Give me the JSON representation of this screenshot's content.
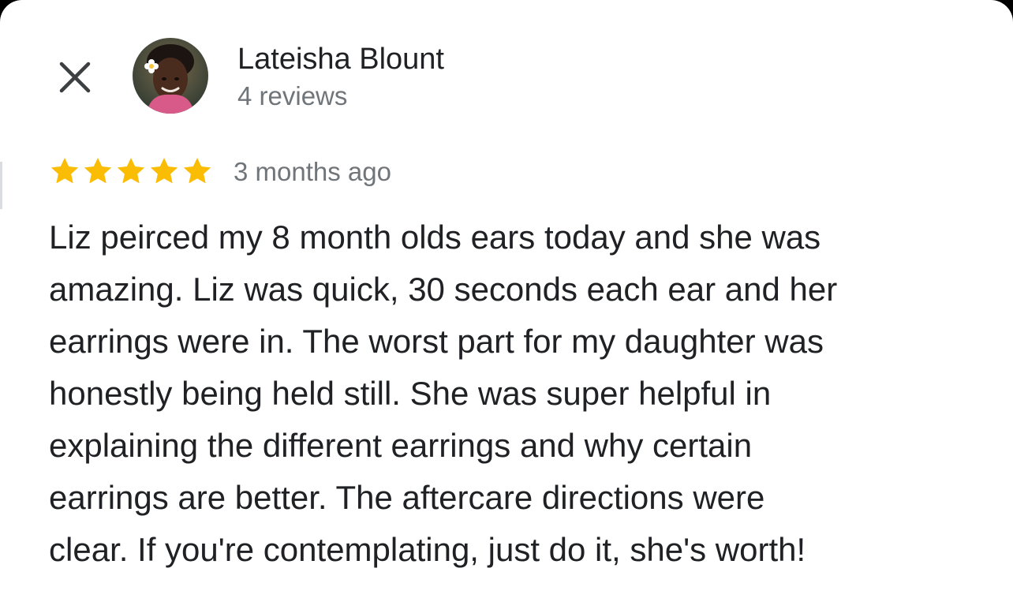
{
  "reviewer": {
    "name": "Lateisha Blount",
    "review_count": "4 reviews",
    "avatar_icon": "profile-photo"
  },
  "close": {
    "icon": "close-icon"
  },
  "review": {
    "rating": 5,
    "rating_max": 5,
    "star_color": "#fbbc04",
    "date": "3 months ago",
    "lines": [
      "Liz peirced my 8 month olds ears today and she was",
      "amazing. Liz was quick, 30 seconds each ear and her",
      "earrings were in. The worst part for my daughter was",
      "honestly being held still. She was super helpful in",
      "explaining the different earrings and why certain",
      "earrings are better. The aftercare directions were",
      "clear. If you're contemplating, just do it, she's worth!"
    ]
  }
}
